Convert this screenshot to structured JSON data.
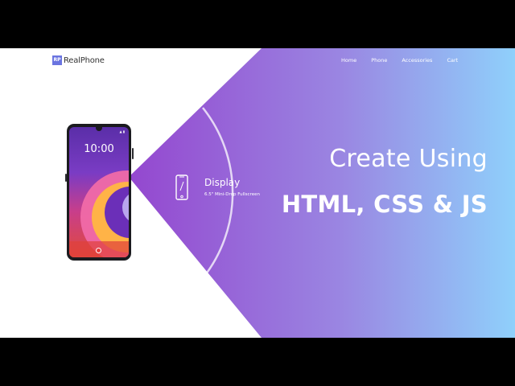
{
  "brand": {
    "logo_mark": "RP",
    "name": "RealPhone"
  },
  "nav": {
    "items": [
      "Home",
      "Phone",
      "Accessories",
      "Cart"
    ]
  },
  "phone": {
    "status": "▲ ▮",
    "time": "10:00",
    "date": ""
  },
  "feature": {
    "title": "Display",
    "subtitle": "6.5\" Mini-Drop Fullscreen",
    "icon": "phone-outline-icon"
  },
  "headline": {
    "line1": "Create Using",
    "line2": "HTML, CSS & JS"
  },
  "colors": {
    "gradient_start": "#9a4fd3",
    "gradient_mid": "#8e7fe4",
    "gradient_end": "#8fcdfb",
    "logo_accent": "#6a74e0",
    "letterbox": "#000000"
  }
}
